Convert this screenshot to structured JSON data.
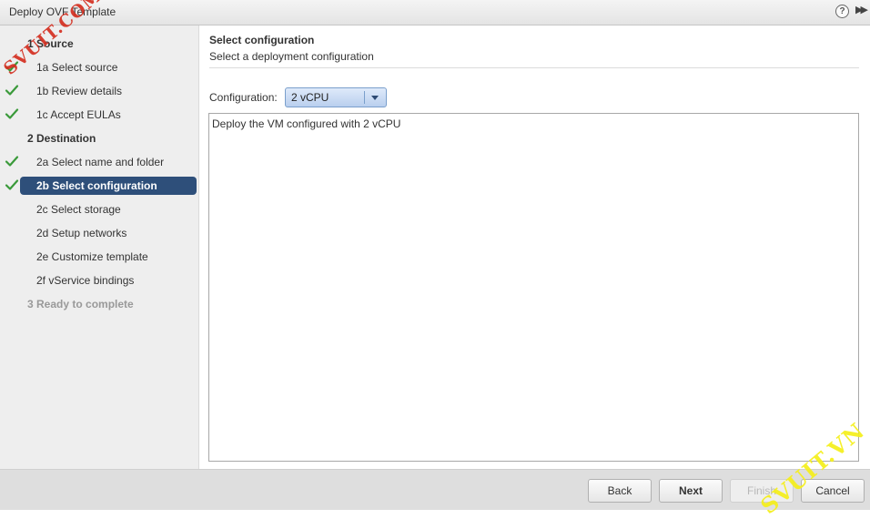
{
  "window": {
    "title": "Deploy OVF Template",
    "help_icon": "?",
    "popout_icon": "▶▶"
  },
  "wizard_steps": [
    {
      "label": "1  Source",
      "type": "section",
      "completed": false,
      "active": false,
      "disabled": false
    },
    {
      "label": "1a  Select source",
      "type": "sub",
      "completed": true,
      "active": false,
      "disabled": false
    },
    {
      "label": "1b  Review details",
      "type": "sub",
      "completed": true,
      "active": false,
      "disabled": false
    },
    {
      "label": "1c  Accept EULAs",
      "type": "sub",
      "completed": true,
      "active": false,
      "disabled": false
    },
    {
      "label": "2  Destination",
      "type": "section",
      "completed": false,
      "active": false,
      "disabled": false
    },
    {
      "label": "2a  Select name and folder",
      "type": "sub",
      "completed": true,
      "active": false,
      "disabled": false
    },
    {
      "label": "2b  Select configuration",
      "type": "sub",
      "completed": true,
      "active": true,
      "disabled": false
    },
    {
      "label": "2c  Select storage",
      "type": "sub",
      "completed": false,
      "active": false,
      "disabled": false
    },
    {
      "label": "2d  Setup networks",
      "type": "sub",
      "completed": false,
      "active": false,
      "disabled": false
    },
    {
      "label": "2e  Customize template",
      "type": "sub",
      "completed": false,
      "active": false,
      "disabled": false
    },
    {
      "label": "2f  vService bindings",
      "type": "sub",
      "completed": false,
      "active": false,
      "disabled": false
    },
    {
      "label": "3  Ready to complete",
      "type": "section",
      "completed": false,
      "active": false,
      "disabled": true
    }
  ],
  "content": {
    "title": "Select configuration",
    "subtitle": "Select a deployment configuration",
    "configuration_label": "Configuration:",
    "configuration_value": "2 vCPU",
    "description": "Deploy the VM configured with 2 vCPU"
  },
  "footer": {
    "back_label": "Back",
    "next_label": "Next",
    "finish_label": "Finish",
    "cancel_label": "Cancel"
  },
  "watermarks": {
    "top_left": "SVUIT.COM",
    "bottom_right": "SVUIT.VN"
  },
  "colors": {
    "active_step_bg": "#2e4f7a",
    "check_color": "#3a9a3a",
    "select_border": "#7a9fcc"
  }
}
